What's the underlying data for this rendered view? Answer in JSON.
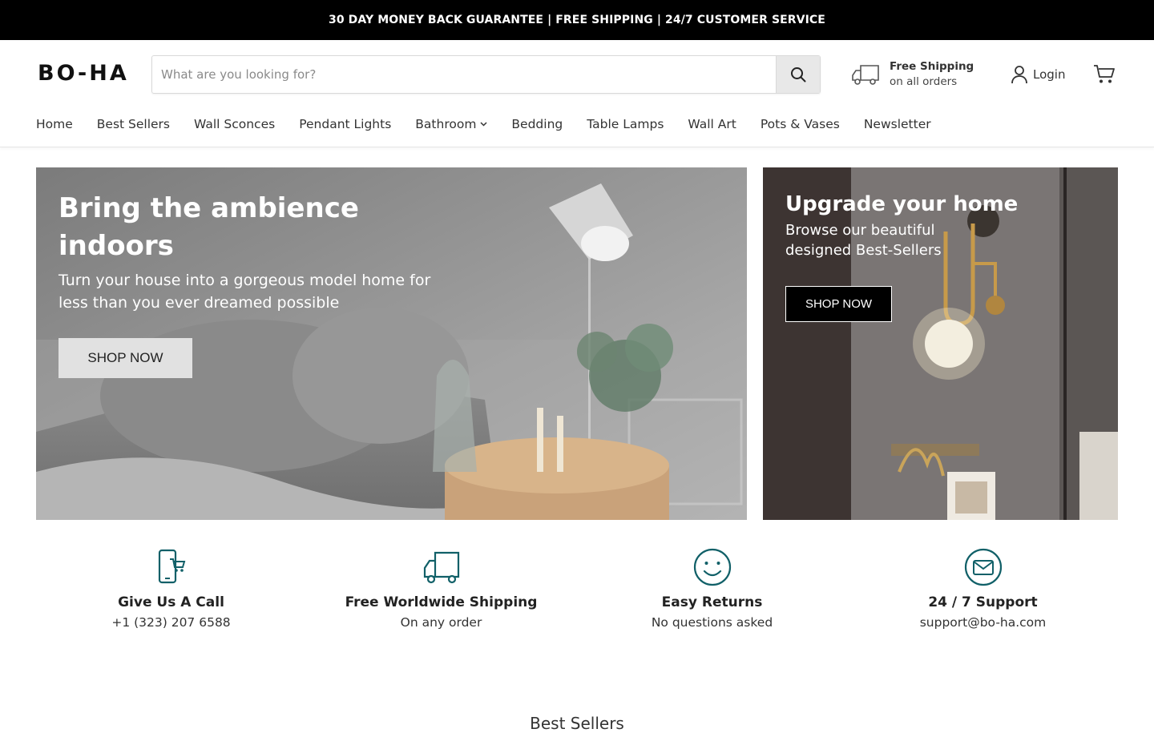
{
  "announcement": "30 DAY MONEY BACK GUARANTEE | FREE SHIPPING | 24/7 CUSTOMER SERVICE",
  "header": {
    "logo": "BO-HA",
    "search": {
      "placeholder": "What are you looking for?",
      "value": ""
    },
    "shipping": {
      "title": "Free Shipping",
      "subtitle": "on all orders"
    },
    "login_label": "Login"
  },
  "nav": {
    "items": [
      {
        "label": "Home"
      },
      {
        "label": "Best Sellers"
      },
      {
        "label": "Wall Sconces"
      },
      {
        "label": "Pendant Lights"
      },
      {
        "label": "Bathroom"
      },
      {
        "label": "Bedding"
      },
      {
        "label": "Table Lamps"
      },
      {
        "label": "Wall Art"
      },
      {
        "label": "Pots & Vases"
      },
      {
        "label": "Newsletter"
      }
    ]
  },
  "hero_main": {
    "title_line1": "Bring the ambience",
    "title_line2": "indoors",
    "text_line1": "Turn your house into a gorgeous model home for",
    "text_line2": "less than you ever dreamed possible",
    "button": "SHOP NOW"
  },
  "hero_side": {
    "title": "Upgrade your home",
    "text_line1": "Browse our beautiful",
    "text_line2": "designed Best-Sellers",
    "button": "SHOP NOW"
  },
  "features": [
    {
      "title": "Give Us A Call",
      "subtitle": "+1 (323) 207 6588",
      "icon": "phone-cart-icon"
    },
    {
      "title": "Free Worldwide Shipping",
      "subtitle": "On any order",
      "icon": "truck-icon"
    },
    {
      "title": "Easy Returns",
      "subtitle": "No questions asked",
      "icon": "smiley-icon"
    },
    {
      "title": "24 / 7 Support",
      "subtitle": "support@bo-ha.com",
      "icon": "envelope-icon"
    }
  ],
  "colors": {
    "accent": "#116068",
    "announcement_bg": "#000000"
  },
  "next_section_title": "Best Sellers"
}
